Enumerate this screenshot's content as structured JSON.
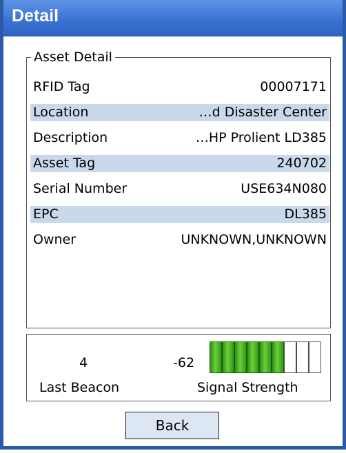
{
  "window": {
    "title": "Detail"
  },
  "asset_detail": {
    "legend": "Asset Detail",
    "rows": [
      {
        "label": "RFID Tag",
        "value": "00007171",
        "shaded": false
      },
      {
        "label": "Location",
        "value": "…d Disaster Center",
        "shaded": true
      },
      {
        "label": "Description",
        "value": "…HP Prolient LD385",
        "shaded": false
      },
      {
        "label": "Asset Tag",
        "value": "240702",
        "shaded": true
      },
      {
        "label": "Serial Number",
        "value": "USE634N080",
        "shaded": false
      },
      {
        "label": "EPC",
        "value": "DL385",
        "shaded": true
      },
      {
        "label": "Owner",
        "value": "UNKNOWN,UNKNOWN",
        "shaded": false
      }
    ]
  },
  "signal": {
    "last_beacon_value": "4",
    "last_beacon_label": "Last Beacon",
    "signal_value": "-62",
    "signal_label": "Signal Strength",
    "bars_total": 9,
    "bars_filled": 6,
    "bar_color": "#4caf2c"
  },
  "actions": {
    "back_label": "Back"
  },
  "colors": {
    "title_bar": "#3c73d3",
    "row_shade": "#c9d8ea",
    "window_border": "#2b5aa8"
  }
}
